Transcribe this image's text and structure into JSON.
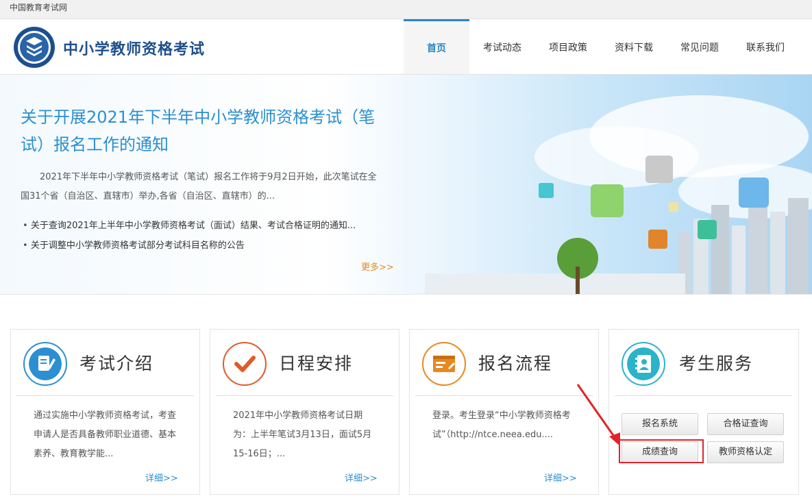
{
  "topbar": {
    "site_name": "中国教育考试网"
  },
  "header": {
    "title": "中小学教师资格考试",
    "nav": [
      {
        "label": "首页",
        "active": true
      },
      {
        "label": "考试动态",
        "active": false
      },
      {
        "label": "项目政策",
        "active": false
      },
      {
        "label": "资料下载",
        "active": false
      },
      {
        "label": "常见问题",
        "active": false
      },
      {
        "label": "联系我们",
        "active": false
      }
    ]
  },
  "banner": {
    "headline": "关于开展2021年下半年中小学教师资格考试（笔试）报名工作的通知",
    "summary": "2021年下半年中小学教师资格考试（笔试）报名工作将于9月2日开始，此次笔试在全国31个省（自治区、直辖市）举办,各省（自治区、直辖市）的...",
    "list": [
      "关于查询2021年上半年中小学教师资格考试（面试）结果、考试合格证明的通知...",
      "关于调整中小学教师资格考试部分考试科目名称的公告"
    ],
    "more": "更多>>"
  },
  "cards": [
    {
      "title": "考试介绍",
      "text": "通过实施中小学教师资格考试，考查申请人是否具备教师职业道德、基本素养、教育教学能...",
      "more": "详细>>"
    },
    {
      "title": "日程安排",
      "text": "2021年中小学教师资格考试日期为：上半年笔试3月13日，面试5月15-16日；...",
      "more": "详细>>"
    },
    {
      "title": "报名流程",
      "text": "登录。考生登录“中小学教师资格考试”（http://ntce.neea.edu....",
      "more": "详细>>"
    },
    {
      "title": "考生服务"
    }
  ],
  "services": {
    "registration": "报名系统",
    "certificate_query": "合格证查询",
    "score_query": "成绩查询",
    "qualification": "教师资格认定"
  },
  "colors": {
    "accent": "#2a84c6",
    "more": "#e8881f",
    "highlight": "#e0232a"
  }
}
